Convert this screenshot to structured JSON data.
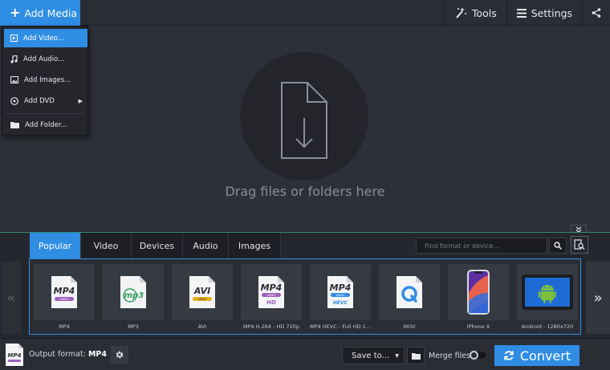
{
  "topbar": {
    "add_media_label": "Add Media",
    "tools_label": "Tools",
    "settings_label": "Settings"
  },
  "add_menu": {
    "items": [
      {
        "label": "Add Video...",
        "icon": "film-icon",
        "active": true
      },
      {
        "label": "Add Audio...",
        "icon": "music-note-icon"
      },
      {
        "label": "Add Images...",
        "icon": "image-icon"
      },
      {
        "label": "Add DVD",
        "icon": "disc-icon",
        "submenu": true
      },
      {
        "label": "Add Folder...",
        "icon": "folder-icon"
      }
    ]
  },
  "drop_area": {
    "text": "Drag files or folders here"
  },
  "format_panel": {
    "tabs": [
      "Popular",
      "Video",
      "Devices",
      "Audio",
      "Images"
    ],
    "active_tab": "Popular",
    "search_placeholder": "Find format or device...",
    "formats": [
      {
        "label": "MP4",
        "badge": "MP4",
        "sub": "VIDEO",
        "sub_color": "#9b5fc0"
      },
      {
        "label": "MP3",
        "badge": "mp3",
        "sub": "",
        "sub_color": "#2e9e5b"
      },
      {
        "label": "AVI",
        "badge": "AVI",
        "sub": "VIDEO",
        "sub_color": "#e2b21b"
      },
      {
        "label": "MP4 H.264 - HD 720p",
        "badge": "MP4",
        "sub": "VIDEO",
        "sub_color": "#9b5fc0",
        "extra": "HD"
      },
      {
        "label": "MP4 HEVC - Full HD 1...",
        "badge": "MP4",
        "sub": "VIDEO",
        "sub_color": "#2f8de4",
        "extra": "HEVC"
      },
      {
        "label": "MOV",
        "badge": "Q",
        "sub": "",
        "sub_color": "#2f8de4"
      },
      {
        "label": "iPhone X",
        "badge": "",
        "sub": "",
        "sub_color": "#ff6a3d"
      },
      {
        "label": "Android - 1280x720",
        "badge": "",
        "sub": "",
        "sub_color": "#7cbf3d"
      }
    ]
  },
  "bottom_bar": {
    "output_format_label": "Output format:",
    "output_format_value": "MP4",
    "output_icon_text": "MP4",
    "save_to_label": "Save to...",
    "merge_files_label": "Merge files",
    "merge_files_on": false,
    "convert_label": "Convert"
  }
}
